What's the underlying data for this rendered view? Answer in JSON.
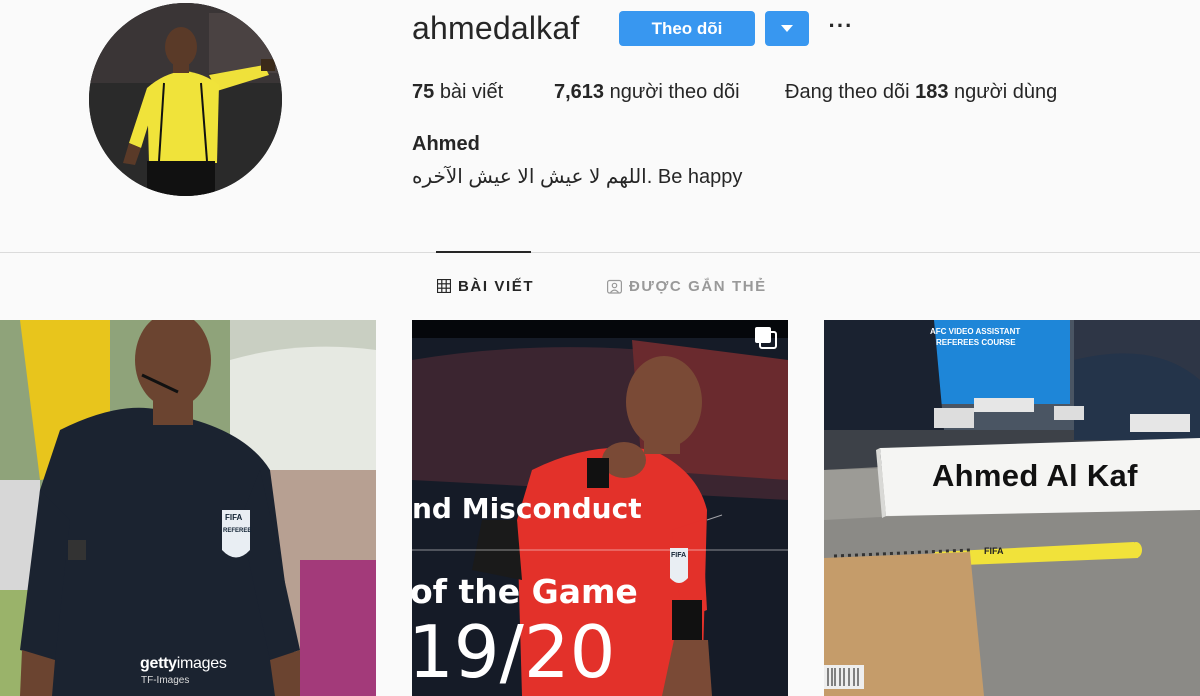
{
  "profile": {
    "username": "ahmedalkaf",
    "follow_label": "Theo dõi",
    "stats": {
      "posts_count": "75",
      "posts_label": "bài viết",
      "followers_count": "7,613",
      "followers_label": "người theo dõi",
      "following_prefix": "Đang theo dõi",
      "following_count": "183",
      "following_suffix": "người dùng"
    },
    "full_name": "Ahmed",
    "bio": "اللهم لا عيش الا عيش الآخره. Be happy"
  },
  "tabs": [
    {
      "label": "BÀI VIẾT",
      "icon": "grid-icon",
      "active": true
    },
    {
      "label": "ĐƯỢC GẮN THẺ",
      "icon": "tagged-icon",
      "active": false
    }
  ],
  "posts": [
    {
      "watermark_brand": "getty",
      "watermark_brand_light": "images",
      "watermark_sub": "TF-Images",
      "badge_fifa": "FIFA",
      "badge_referee": "REFEREE"
    },
    {
      "line1": "nd Misconduct",
      "line2": "of the Game",
      "line3": "19/20",
      "badge_fifa": "FIFA"
    },
    {
      "placard": "Ahmed Al Kaf",
      "screen_line1": "AFC VIDEO ASSISTANT",
      "screen_line2": "REFEREES COURSE",
      "pencil_brand": "FIFA"
    }
  ],
  "colors": {
    "background": "#fafafa",
    "accent_blue": "#3897f0",
    "text": "#262626",
    "muted": "#999999",
    "divider": "#dbdbdb",
    "referee_yellow": "#f0e33a",
    "referee_red": "#e3312a"
  }
}
